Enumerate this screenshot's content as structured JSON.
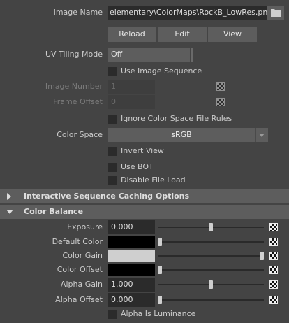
{
  "image_name": {
    "label": "Image Name",
    "value": "elementary\\ColorMaps\\RockB_LowRes.png",
    "folder_icon": "folder-icon"
  },
  "buttons": {
    "reload": "Reload",
    "edit": "Edit",
    "view": "View"
  },
  "uv_tiling": {
    "label": "UV Tiling Mode",
    "value": "Off"
  },
  "use_image_sequence": {
    "label": "Use Image Sequence"
  },
  "image_number": {
    "label": "Image Number",
    "value": "1"
  },
  "frame_offset": {
    "label": "Frame Offset",
    "value": "0"
  },
  "ignore_cs_rules": {
    "label": "Ignore Color Space File Rules"
  },
  "color_space": {
    "label": "Color Space",
    "value": "sRGB"
  },
  "invert_view": {
    "label": "Invert View"
  },
  "use_bot": {
    "label": "Use BOT"
  },
  "disable_file_load": {
    "label": "Disable File Load"
  },
  "sections": {
    "interactive_caching": "Interactive Sequence Caching Options",
    "color_balance": "Color Balance"
  },
  "color_balance": {
    "exposure": {
      "label": "Exposure",
      "value": "0.000",
      "slider": 0.5
    },
    "default_color": {
      "label": "Default Color",
      "color": "#000000",
      "slider": 0.0
    },
    "color_gain": {
      "label": "Color Gain",
      "color": "#cfcfcf",
      "slider": 1.0
    },
    "color_offset": {
      "label": "Color Offset",
      "color": "#000000",
      "slider": 0.0
    },
    "alpha_gain": {
      "label": "Alpha Gain",
      "value": "1.000",
      "slider": 0.5
    },
    "alpha_offset": {
      "label": "Alpha Offset",
      "value": "0.000",
      "slider": 0.0
    },
    "alpha_is_luminance": {
      "label": "Alpha Is Luminance"
    }
  }
}
